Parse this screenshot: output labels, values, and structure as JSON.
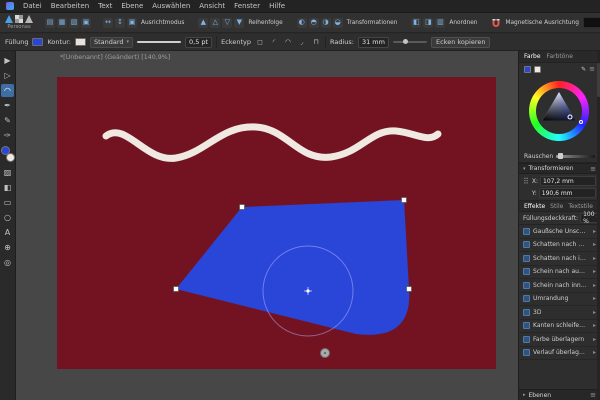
{
  "colors": {
    "accent_blue": "#3f6ea5",
    "artboard_red": "#731322",
    "shape_blue": "#2a46d8",
    "wave_white": "#efe9e2",
    "magnet_red": "#e4564a"
  },
  "icons": {
    "caret": "▾",
    "menu": "≡",
    "expand": "▸",
    "anchor": "⠿",
    "eyedropper": "✎"
  },
  "menu": {
    "items": [
      "Datei",
      "Bearbeiten",
      "Text",
      "Ebene",
      "Auswählen",
      "Ansicht",
      "Fenster",
      "Hilfe"
    ]
  },
  "toolbar": {
    "personas_label": "Personas",
    "group_labels": [
      "Ausrichtmodus",
      "Reihenfolge",
      "Transformationen",
      "Anordnen",
      "Magnetische Ausrichtung"
    ],
    "doc_icons": [
      "▤",
      "▦",
      "▧",
      "▣"
    ],
    "align_icons": [
      "↔",
      "↕",
      "▣"
    ],
    "order_icons": [
      "▲",
      "△",
      "▽",
      "▼"
    ],
    "transform_icons": [
      "◐",
      "◓",
      "◑",
      "◒"
    ],
    "arrange_icons": [
      "◧",
      "◨",
      "▥"
    ]
  },
  "context": {
    "fill_label": "Füllung",
    "stroke_label": "Kontur:",
    "stroke_style": "Standard",
    "stroke_width": "0,5 pt",
    "corner_type_label": "Eckentyp",
    "corner_icons": [
      "◻",
      "◜",
      "◠",
      "◞",
      "⊓"
    ],
    "radius_label": "Radius:",
    "radius_value": "31 mm",
    "bake_corners_label": "Ecken kopieren"
  },
  "canvas": {
    "doc_tab": "*[Unbenannt] (Geändert) [140,9%]"
  },
  "tools": {
    "items": [
      {
        "glyph": "▶"
      },
      {
        "glyph": "▷"
      },
      {
        "glyph": "◠"
      },
      {
        "glyph": "✒"
      },
      {
        "glyph": "✎"
      },
      {
        "glyph": "✑"
      },
      {
        "glyph": "▨"
      },
      {
        "glyph": "◧"
      },
      {
        "glyph": "▭"
      },
      {
        "glyph": "○"
      },
      {
        "glyph": "A"
      },
      {
        "glyph": "⊕"
      },
      {
        "glyph": "◎"
      }
    ]
  },
  "right": {
    "color_tabs": [
      "Farbe",
      "Farbtöne"
    ],
    "noise_label": "Rauschen",
    "transform": {
      "title": "Transformieren",
      "x_label": "X:",
      "x_value": "107,2 mm",
      "y_label": "Y:",
      "y_value": "190,6 mm"
    },
    "effect_tabs": [
      "Effekte",
      "Stile",
      "Textstile"
    ],
    "opacity_label": "Füllungsdeckkraft:",
    "opacity_value": "100 %",
    "effects": [
      "Gaußsche Unschärfe",
      "Schatten nach außen",
      "Schatten nach innen",
      "Schein nach außen",
      "Schein nach innen",
      "Umrandung",
      "3D",
      "Kanten schleifen / Relief",
      "Farbe überlagern",
      "Verlauf überlagern"
    ],
    "bottom_panel": "Ebenen"
  }
}
